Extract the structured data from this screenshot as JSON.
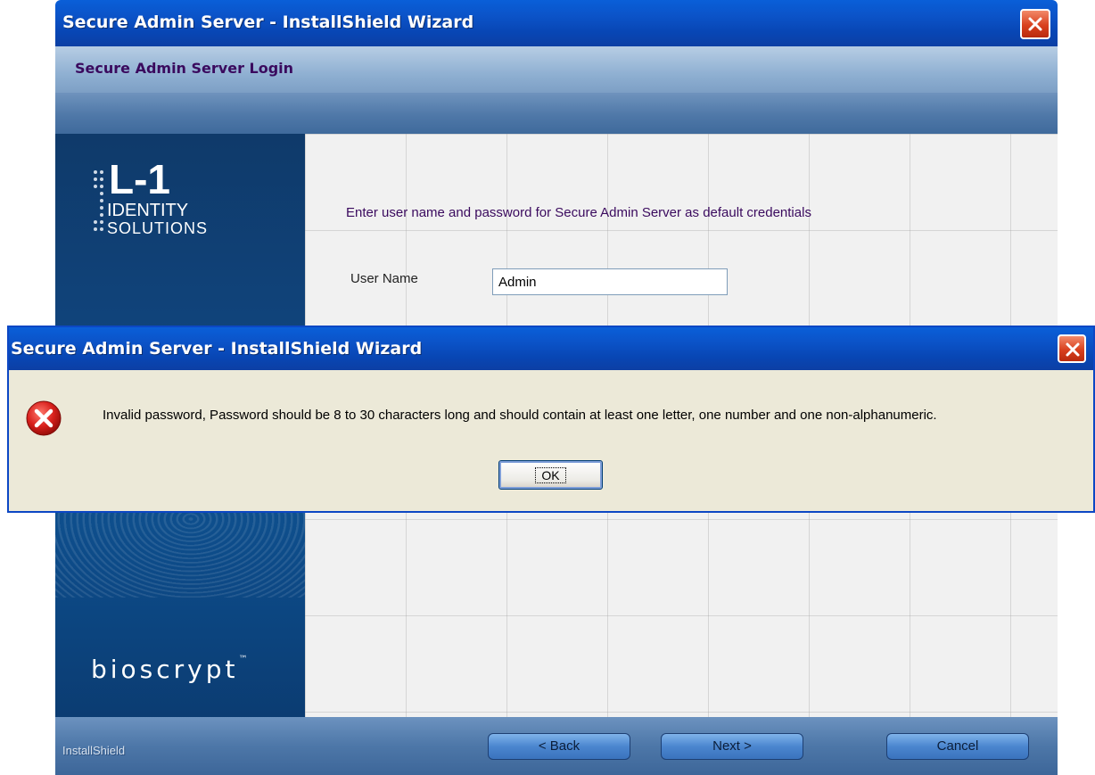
{
  "wizard": {
    "title": "Secure Admin Server - InstallShield Wizard",
    "heading": "Secure Admin Server Login",
    "logo": {
      "top": "L-1",
      "identity": "IDENTITY",
      "solutions": "SOLUTIONS",
      "bottom": "bioscrypt",
      "bottom_mark": "™"
    },
    "prompt": "Enter user name and password for Secure Admin Server as default credentials",
    "user_name_label": "User Name",
    "user_name_value": "Admin",
    "footer_brand": "InstallShield",
    "buttons": {
      "back": "< Back",
      "next": "Next >",
      "cancel": "Cancel"
    }
  },
  "dialog": {
    "title": "Secure Admin Server - InstallShield Wizard",
    "icon": "error-icon",
    "message": "Invalid password, Password should be 8 to 30 characters long and should contain at least one letter, one number and one non-alphanumeric.",
    "ok_label": "OK"
  },
  "colors": {
    "titlebar": "#0b53c8",
    "close": "#d8401e",
    "heading_text": "#3a0a5e",
    "sidebar": "#10447c",
    "dialog_bg": "#ece9d8",
    "error_red": "#d8201c"
  }
}
